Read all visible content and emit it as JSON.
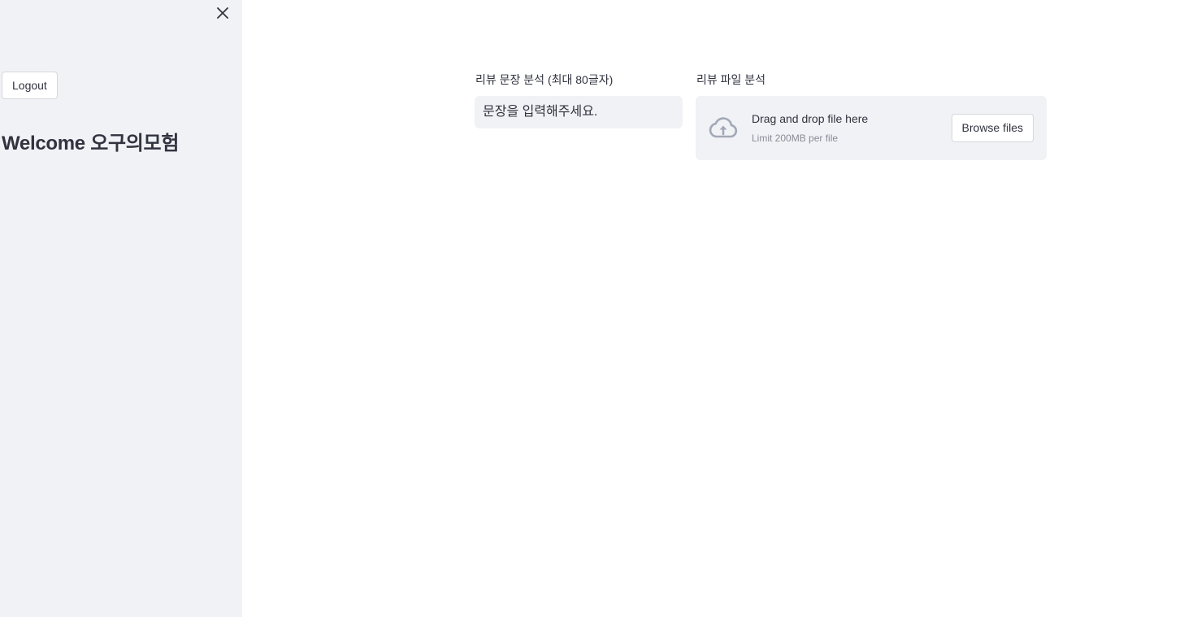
{
  "sidebar": {
    "logout_label": "Logout",
    "welcome_text": "Welcome 오구의모험",
    "close_icon": "close-icon"
  },
  "main": {
    "text_analysis": {
      "label": "리뷰 문장 분석 (최대 80글자)",
      "placeholder": "문장을 입력해주세요.",
      "value": ""
    },
    "file_analysis": {
      "label": "리뷰 파일 분석",
      "dropzone_title": "Drag and drop file here",
      "dropzone_limit": "Limit 200MB per file",
      "browse_label": "Browse files",
      "upload_icon": "cloud-upload-icon"
    }
  },
  "colors": {
    "sidebar_bg": "#f0f2f6",
    "text": "#31333f",
    "muted": "#8a8d96",
    "icon": "#a3a8b8"
  }
}
